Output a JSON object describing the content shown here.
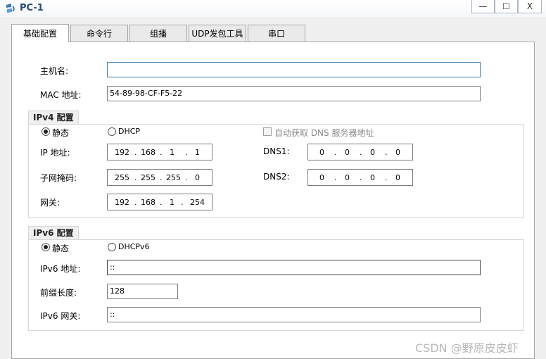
{
  "window": {
    "title": "PC-1",
    "controls": {
      "minimize": "—",
      "maximize": "☐",
      "close": "X"
    }
  },
  "tabs": [
    {
      "label": "基础配置",
      "active": true
    },
    {
      "label": "命令行",
      "active": false
    },
    {
      "label": "组播",
      "active": false
    },
    {
      "label": "UDP发包工具",
      "active": false
    },
    {
      "label": "串口",
      "active": false
    }
  ],
  "basic": {
    "hostname_label": "主机名:",
    "hostname_value": "",
    "mac_label": "MAC 地址:",
    "mac_value": "54-89-98-CF-F5-22"
  },
  "ipv4": {
    "title": "IPv4 配置",
    "static_label": "静态",
    "dhcp_label": "DHCP",
    "auto_dns_label": "自动获取 DNS 服务器地址",
    "ip_label": "IP 地址:",
    "ip": [
      "192",
      "168",
      "1",
      "1"
    ],
    "mask_label": "子网掩码:",
    "mask": [
      "255",
      "255",
      "255",
      "0"
    ],
    "gateway_label": "网关:",
    "gateway": [
      "192",
      "168",
      "1",
      "254"
    ],
    "dns1_label": "DNS1:",
    "dns1": [
      "0",
      "0",
      "0",
      "0"
    ],
    "dns2_label": "DNS2:",
    "dns2": [
      "0",
      "0",
      "0",
      "0"
    ]
  },
  "ipv6": {
    "title": "IPv6 配置",
    "static_label": "静态",
    "dhcp_label": "DHCPv6",
    "addr_label": "IPv6 地址:",
    "addr_value": "::",
    "prefix_label": "前缀长度:",
    "prefix_value": "128",
    "gateway_label": "IPv6 网关:",
    "gateway_value": "::"
  },
  "watermark": "CSDN @野原皮皮虾"
}
